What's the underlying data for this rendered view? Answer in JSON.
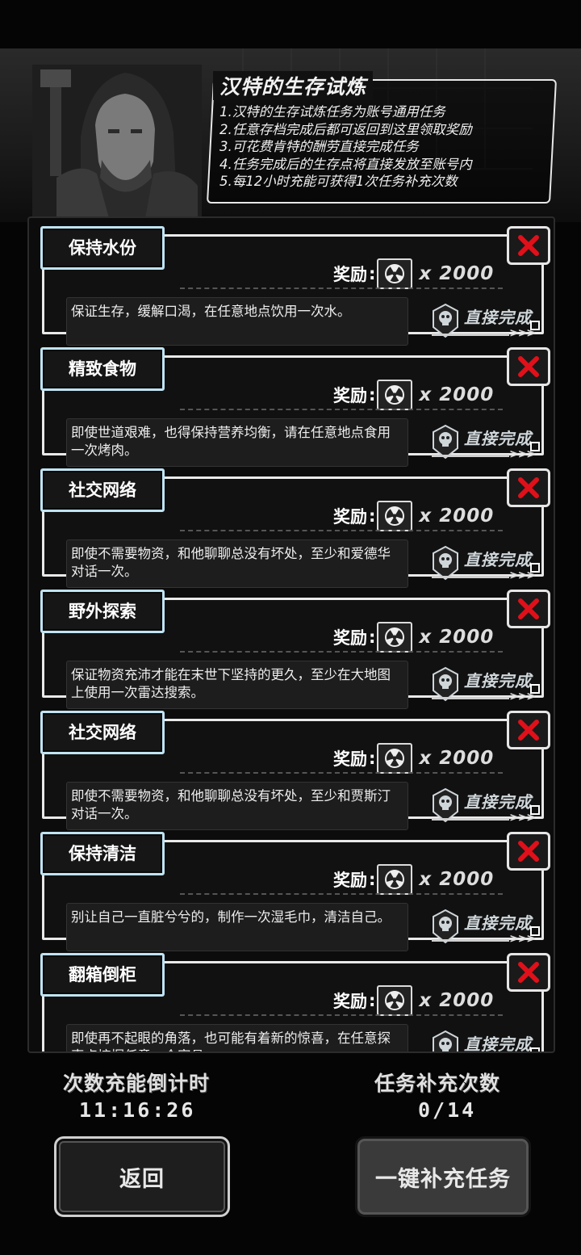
{
  "header": {
    "title": "汉特的生存试炼",
    "rules": [
      "1.汉特的生存试炼任务为账号通用任务",
      "2.任意存档完成后都可返回到这里领取奖励",
      "3.可花费肯特的酬劳直接完成任务",
      "4.任务完成后的生存点将直接发放至账号内",
      "5.每12小时充能可获得1次任务补充次数"
    ]
  },
  "common": {
    "reward_label": "奖励",
    "reward_colon": ":",
    "reward_amount": "x 2000",
    "complete_label": "直接完成",
    "complete_arrows": ">>>"
  },
  "tasks": [
    {
      "title": "保持水份",
      "desc": "保证生存，缓解口渴，在任意地点饮用一次水。"
    },
    {
      "title": "精致食物",
      "desc": "即使世道艰难，也得保持营养均衡，请在任意地点食用一次烤肉。"
    },
    {
      "title": "社交网络",
      "desc": "即使不需要物资，和他聊聊总没有坏处，至少和爱德华对话一次。"
    },
    {
      "title": "野外探索",
      "desc": "保证物资充沛才能在末世下坚持的更久，至少在大地图上使用一次雷达搜索。"
    },
    {
      "title": "社交网络",
      "desc": "即使不需要物资，和他聊聊总没有坏处，至少和贾斯汀对话一次。"
    },
    {
      "title": "保持清洁",
      "desc": "别让自己一直脏兮兮的，制作一次湿毛巾，清洁自己。"
    },
    {
      "title": "翻箱倒柜",
      "desc": "即使再不起眼的角落，也可能有着新的惊喜，在任意探索点挖掘任意一个家具。"
    }
  ],
  "footer": {
    "countdown_label": "次数充能倒计时",
    "countdown_value": "11:16:26",
    "refill_label": "任务补充次数",
    "refill_value": "0/14",
    "back_button": "返回",
    "refill_button": "一键补充任务"
  },
  "colors": {
    "title_border": "#bfe3f3",
    "close_x": "#e0101a",
    "frame": "#e9e9e9"
  }
}
